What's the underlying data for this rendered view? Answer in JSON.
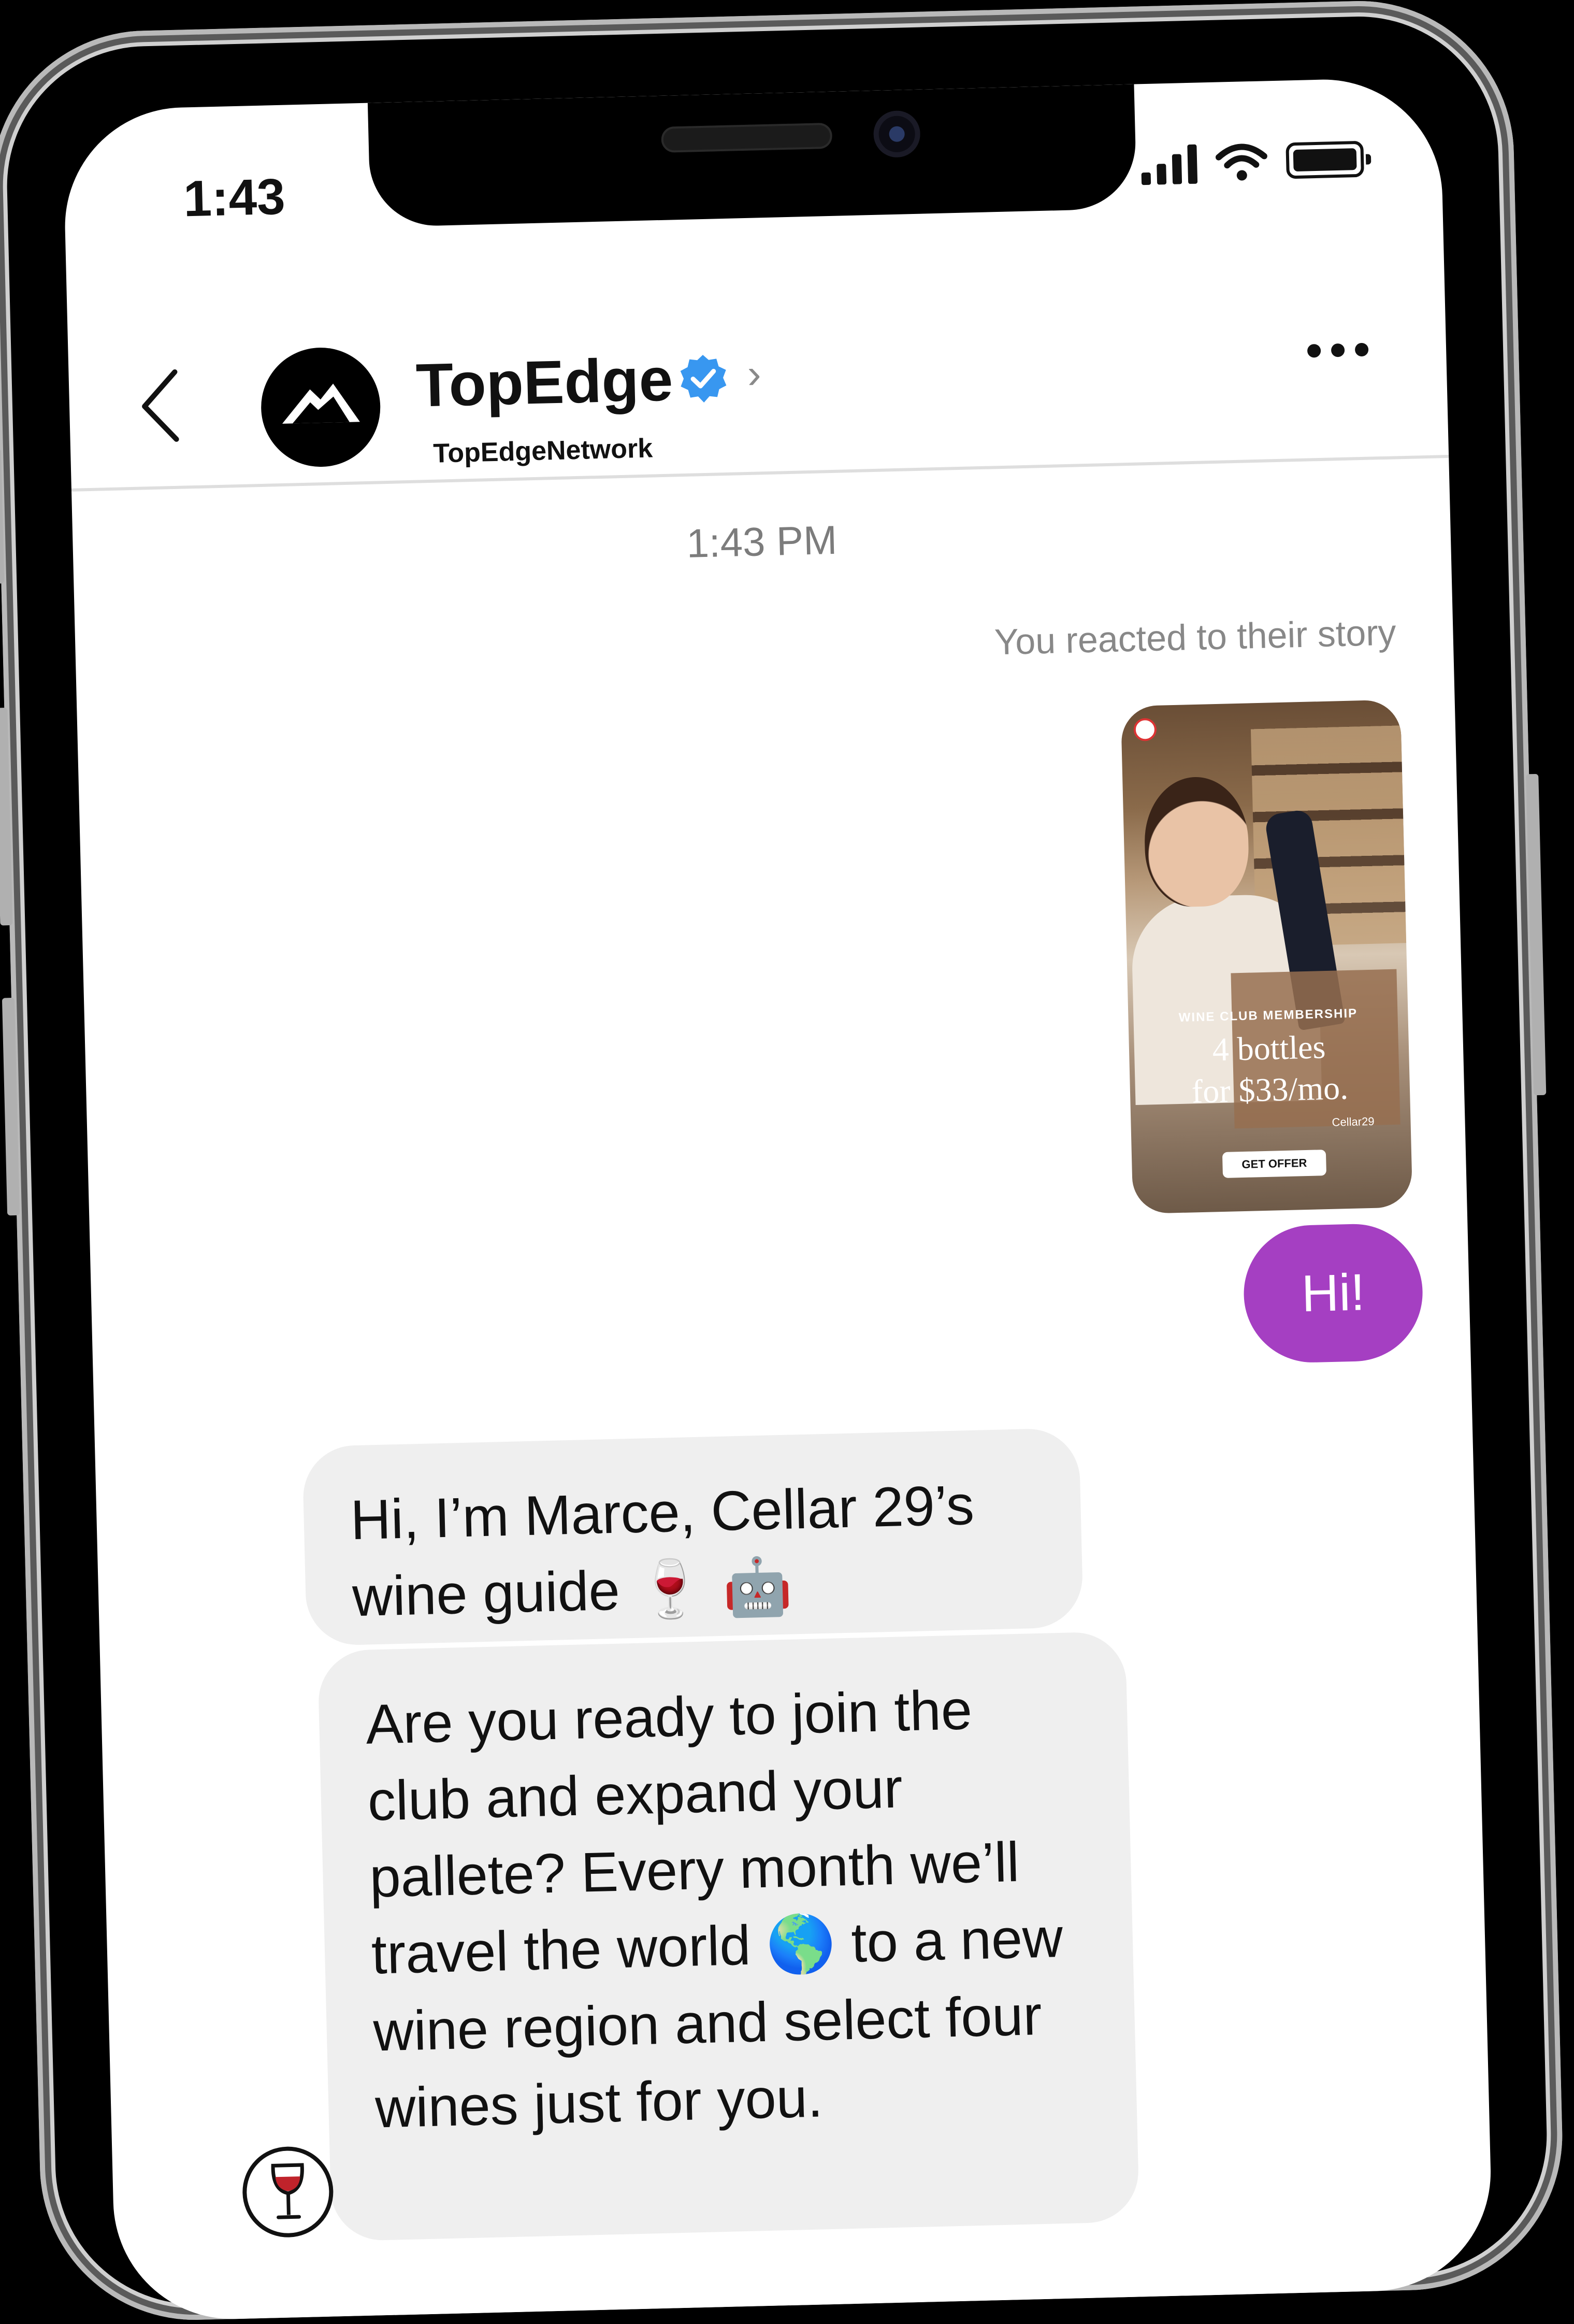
{
  "status_bar": {
    "time": "1:43"
  },
  "header": {
    "name": "TopEdge",
    "handle": "TopEdgeNetwork",
    "back_icon": "chevron-left-icon",
    "verified_icon": "verified-badge-icon",
    "more_icon": "more-horizontal-icon"
  },
  "thread": {
    "timestamp": "1:43 PM",
    "story_reaction_note": "You reacted to their story",
    "story": {
      "club_label": "WINE CLUB MEMBERSHIP",
      "offer_line1": "4 bottles",
      "offer_line2": "for $33/mo.",
      "brand": "Cellar29",
      "cta": "GET OFFER"
    },
    "outgoing_message": "Hi!",
    "incoming_messages": [
      {
        "text": "Hi, I’m Marce, Cellar 29’s wine guide",
        "emojis": "🍷 🤖"
      },
      {
        "text_before": "Are you ready to join the club and expand your pallete? Every month we’ll travel the world",
        "emoji": "🌎",
        "text_after": "to a new wine region and select four wines just for you."
      }
    ]
  },
  "colors": {
    "outgoing_bubble": "#a53fc2",
    "incoming_bubble": "#efefef",
    "verified_blue": "#3897f0"
  }
}
